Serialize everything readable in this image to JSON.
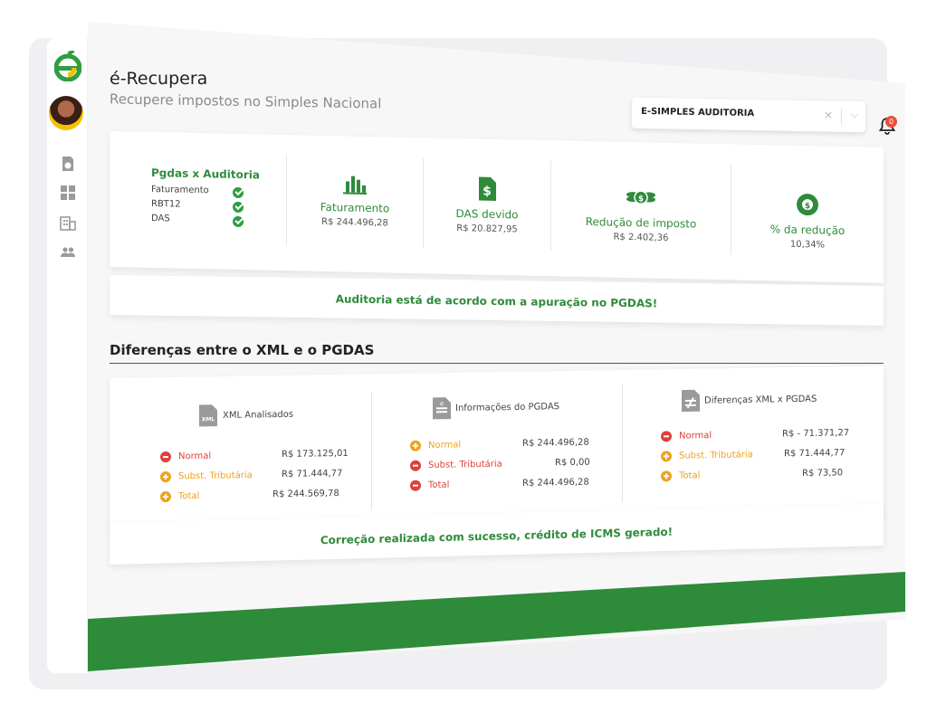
{
  "app": {
    "title": "é-Recupera",
    "subtitle": "Recupere impostos no Simples Nacional"
  },
  "header": {
    "company_select": "E-SIMPLES AUDITORIA",
    "notification_count": "0"
  },
  "sidebar": {
    "items": [
      "dashboard-icon",
      "grid-icon",
      "building-icon",
      "users-icon"
    ]
  },
  "kpis": {
    "audit": {
      "title": "Pgdas x Auditoria",
      "checks": [
        "Faturamento",
        "RBT12",
        "DAS"
      ]
    },
    "faturamento": {
      "label": "Faturamento",
      "value": "R$ 244.496,28"
    },
    "das": {
      "label": "DAS devido",
      "value": "R$ 20.827,95"
    },
    "reducao": {
      "label": "Redução de imposto",
      "value": "R$ 2.402,36"
    },
    "percent": {
      "label": "% da redução",
      "value": "10,34%"
    }
  },
  "banner_top": "Auditoria está de acordo com a apuração no PGDAS!",
  "section_title": "Diferenças entre o XML e o PGDAS",
  "diff": {
    "xml": {
      "title": "XML Analisados",
      "rows": [
        {
          "label": "Normal",
          "value": "R$ 173.125,01"
        },
        {
          "label": "Subst. Tributária",
          "value": "R$ 71.444,77"
        },
        {
          "label": "Total",
          "value": "R$ 244.569,78"
        }
      ]
    },
    "pgdas": {
      "title": "Informações do PGDAS",
      "rows": [
        {
          "label": "Normal",
          "value": "R$ 244.496,28"
        },
        {
          "label": "Subst. Tributária",
          "value": "R$ 0,00"
        },
        {
          "label": "Total",
          "value": "R$ 244.496,28"
        }
      ]
    },
    "delta": {
      "title": "Diferenças XML x PGDAS",
      "rows": [
        {
          "label": "Normal",
          "value": "R$ - 71.371,27"
        },
        {
          "label": "Subst. Tributária",
          "value": "R$ 71.444,77"
        },
        {
          "label": "Total",
          "value": "R$ 73,50"
        }
      ]
    }
  },
  "banner_bottom": "Correção realizada com sucesso, crédito de ICMS gerado!",
  "colors": {
    "brand_green": "#2e8b3a",
    "warning_orange": "#f0a21a",
    "error_red": "#e0403a"
  }
}
